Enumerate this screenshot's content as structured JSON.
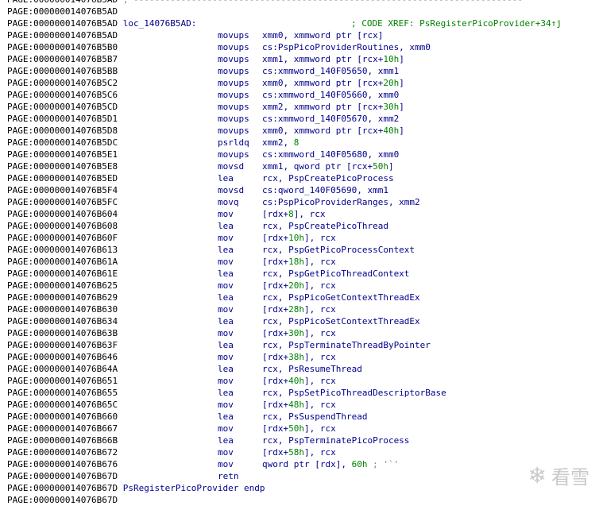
{
  "lines": [
    {
      "addr": "PAGE:000000014076B5AD",
      "comment": ";",
      "dashes": " --------------------------------------------------------------------------"
    },
    {
      "addr": "PAGE:000000014076B5AD",
      "plain": ""
    },
    {
      "addr": "PAGE:000000014076B5AD",
      "label": "loc_14076B5AD:",
      "xref": "; CODE XREF: PsRegisterPicoProvider+34↑j"
    },
    {
      "addr": "PAGE:000000014076B5AD",
      "mnem": "movups",
      "ops": [
        {
          "t": "xmm0, xmmword ptr [rcx]"
        }
      ]
    },
    {
      "addr": "PAGE:000000014076B5B0",
      "mnem": "movups",
      "ops": [
        {
          "t": "cs:PspPicoProviderRoutines, xmm0"
        }
      ]
    },
    {
      "addr": "PAGE:000000014076B5B7",
      "mnem": "movups",
      "ops": [
        {
          "t": "xmm1, xmmword ptr [rcx+"
        },
        {
          "n": "10h"
        },
        {
          "t": "]"
        }
      ]
    },
    {
      "addr": "PAGE:000000014076B5BB",
      "mnem": "movups",
      "ops": [
        {
          "t": "cs:xmmword_140F05650, xmm1"
        }
      ]
    },
    {
      "addr": "PAGE:000000014076B5C2",
      "mnem": "movups",
      "ops": [
        {
          "t": "xmm0, xmmword ptr [rcx+"
        },
        {
          "n": "20h"
        },
        {
          "t": "]"
        }
      ]
    },
    {
      "addr": "PAGE:000000014076B5C6",
      "mnem": "movups",
      "ops": [
        {
          "t": "cs:xmmword_140F05660, xmm0"
        }
      ]
    },
    {
      "addr": "PAGE:000000014076B5CD",
      "mnem": "movups",
      "ops": [
        {
          "t": "xmm2, xmmword ptr [rcx+"
        },
        {
          "n": "30h"
        },
        {
          "t": "]"
        }
      ]
    },
    {
      "addr": "PAGE:000000014076B5D1",
      "mnem": "movups",
      "ops": [
        {
          "t": "cs:xmmword_140F05670, xmm2"
        }
      ]
    },
    {
      "addr": "PAGE:000000014076B5D8",
      "mnem": "movups",
      "ops": [
        {
          "t": "xmm0, xmmword ptr [rcx+"
        },
        {
          "n": "40h"
        },
        {
          "t": "]"
        }
      ]
    },
    {
      "addr": "PAGE:000000014076B5DC",
      "mnem": "psrldq",
      "ops": [
        {
          "t": "xmm2, "
        },
        {
          "n": "8"
        }
      ]
    },
    {
      "addr": "PAGE:000000014076B5E1",
      "mnem": "movups",
      "ops": [
        {
          "t": "cs:xmmword_140F05680, xmm0"
        }
      ]
    },
    {
      "addr": "PAGE:000000014076B5E8",
      "mnem": "movsd",
      "ops": [
        {
          "t": "xmm1, qword ptr [rcx+"
        },
        {
          "n": "50h"
        },
        {
          "t": "]"
        }
      ]
    },
    {
      "addr": "PAGE:000000014076B5ED",
      "mnem": "lea",
      "ops": [
        {
          "t": "rcx, PspCreatePicoProcess"
        }
      ]
    },
    {
      "addr": "PAGE:000000014076B5F4",
      "mnem": "movsd",
      "ops": [
        {
          "t": "cs:qword_140F05690, xmm1"
        }
      ]
    },
    {
      "addr": "PAGE:000000014076B5FC",
      "mnem": "movq",
      "ops": [
        {
          "t": "cs:PspPicoProviderRanges, xmm2"
        }
      ]
    },
    {
      "addr": "PAGE:000000014076B604",
      "mnem": "mov",
      "ops": [
        {
          "t": "[rdx+"
        },
        {
          "n": "8"
        },
        {
          "t": "], rcx"
        }
      ]
    },
    {
      "addr": "PAGE:000000014076B608",
      "mnem": "lea",
      "ops": [
        {
          "t": "rcx, PspCreatePicoThread"
        }
      ]
    },
    {
      "addr": "PAGE:000000014076B60F",
      "mnem": "mov",
      "ops": [
        {
          "t": "[rdx+"
        },
        {
          "n": "10h"
        },
        {
          "t": "], rcx"
        }
      ]
    },
    {
      "addr": "PAGE:000000014076B613",
      "mnem": "lea",
      "ops": [
        {
          "t": "rcx, PspGetPicoProcessContext"
        }
      ]
    },
    {
      "addr": "PAGE:000000014076B61A",
      "mnem": "mov",
      "ops": [
        {
          "t": "[rdx+"
        },
        {
          "n": "18h"
        },
        {
          "t": "], rcx"
        }
      ]
    },
    {
      "addr": "PAGE:000000014076B61E",
      "mnem": "lea",
      "ops": [
        {
          "t": "rcx, PspGetPicoThreadContext"
        }
      ]
    },
    {
      "addr": "PAGE:000000014076B625",
      "mnem": "mov",
      "ops": [
        {
          "t": "[rdx+"
        },
        {
          "n": "20h"
        },
        {
          "t": "], rcx"
        }
      ]
    },
    {
      "addr": "PAGE:000000014076B629",
      "mnem": "lea",
      "ops": [
        {
          "t": "rcx, PspPicoGetContextThreadEx"
        }
      ]
    },
    {
      "addr": "PAGE:000000014076B630",
      "mnem": "mov",
      "ops": [
        {
          "t": "[rdx+"
        },
        {
          "n": "28h"
        },
        {
          "t": "], rcx"
        }
      ]
    },
    {
      "addr": "PAGE:000000014076B634",
      "mnem": "lea",
      "ops": [
        {
          "t": "rcx, PspPicoSetContextThreadEx"
        }
      ]
    },
    {
      "addr": "PAGE:000000014076B63B",
      "mnem": "mov",
      "ops": [
        {
          "t": "[rdx+"
        },
        {
          "n": "30h"
        },
        {
          "t": "], rcx"
        }
      ]
    },
    {
      "addr": "PAGE:000000014076B63F",
      "mnem": "lea",
      "ops": [
        {
          "t": "rcx, PspTerminateThreadByPointer"
        }
      ]
    },
    {
      "addr": "PAGE:000000014076B646",
      "mnem": "mov",
      "ops": [
        {
          "t": "[rdx+"
        },
        {
          "n": "38h"
        },
        {
          "t": "], rcx"
        }
      ]
    },
    {
      "addr": "PAGE:000000014076B64A",
      "mnem": "lea",
      "ops": [
        {
          "t": "rcx, PsResumeThread"
        }
      ]
    },
    {
      "addr": "PAGE:000000014076B651",
      "mnem": "mov",
      "ops": [
        {
          "t": "[rdx+"
        },
        {
          "n": "40h"
        },
        {
          "t": "], rcx"
        }
      ]
    },
    {
      "addr": "PAGE:000000014076B655",
      "mnem": "lea",
      "ops": [
        {
          "t": "rcx, PspSetPicoThreadDescriptorBase"
        }
      ]
    },
    {
      "addr": "PAGE:000000014076B65C",
      "mnem": "mov",
      "ops": [
        {
          "t": "[rdx+"
        },
        {
          "n": "48h"
        },
        {
          "t": "], rcx"
        }
      ]
    },
    {
      "addr": "PAGE:000000014076B660",
      "mnem": "lea",
      "ops": [
        {
          "t": "rcx, PsSuspendThread"
        }
      ]
    },
    {
      "addr": "PAGE:000000014076B667",
      "mnem": "mov",
      "ops": [
        {
          "t": "[rdx+"
        },
        {
          "n": "50h"
        },
        {
          "t": "], rcx"
        }
      ]
    },
    {
      "addr": "PAGE:000000014076B66B",
      "mnem": "lea",
      "ops": [
        {
          "t": "rcx, PspTerminatePicoProcess"
        }
      ]
    },
    {
      "addr": "PAGE:000000014076B672",
      "mnem": "mov",
      "ops": [
        {
          "t": "[rdx+"
        },
        {
          "n": "58h"
        },
        {
          "t": "], rcx"
        }
      ]
    },
    {
      "addr": "PAGE:000000014076B676",
      "mnem": "mov",
      "ops": [
        {
          "t": "qword ptr [rdx], "
        },
        {
          "n": "60h"
        },
        {
          "t": " "
        },
        {
          "c": "; '`'"
        }
      ]
    },
    {
      "addr": "PAGE:000000014076B67D",
      "mnem": "retn",
      "ops": []
    },
    {
      "addr": "PAGE:000000014076B67D",
      "label": "PsRegisterPicoProvider endp"
    },
    {
      "addr": "PAGE:000000014076B67D",
      "plain": ""
    }
  ],
  "watermark": {
    "icon": "snowflake-icon",
    "text": "看雪"
  }
}
